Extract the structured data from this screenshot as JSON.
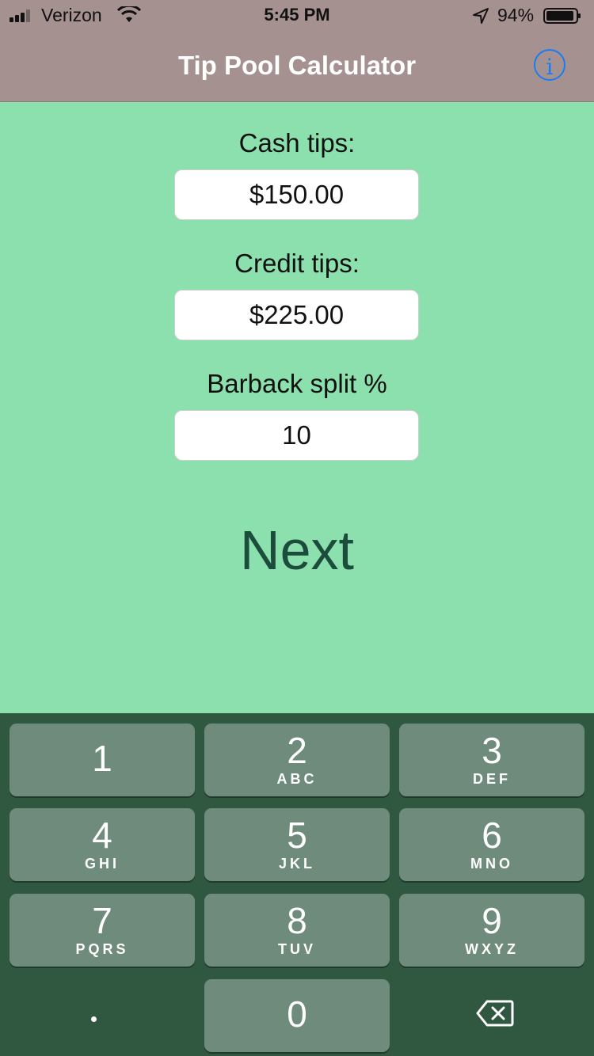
{
  "status_bar": {
    "carrier": "Verizon",
    "time": "5:45 PM",
    "battery_percent": "94%"
  },
  "nav": {
    "title": "Tip Pool Calculator",
    "info_glyph": "i"
  },
  "form": {
    "cash_label": "Cash tips:",
    "cash_value": "$150.00",
    "credit_label": "Credit tips:",
    "credit_value": "$225.00",
    "barback_label": "Barback split %",
    "barback_value": "10",
    "next_label": "Next"
  },
  "keypad": {
    "keys": [
      {
        "num": "1",
        "letters": ""
      },
      {
        "num": "2",
        "letters": "ABC"
      },
      {
        "num": "3",
        "letters": "DEF"
      },
      {
        "num": "4",
        "letters": "GHI"
      },
      {
        "num": "5",
        "letters": "JKL"
      },
      {
        "num": "6",
        "letters": "MNO"
      },
      {
        "num": "7",
        "letters": "PQRS"
      },
      {
        "num": "8",
        "letters": "TUV"
      },
      {
        "num": "9",
        "letters": "WXYZ"
      },
      {
        "num": "0",
        "letters": ""
      }
    ]
  },
  "colors": {
    "background": "#8be0ad",
    "nav_bar": "#a49190",
    "accent": "#1a7cf5",
    "keypad_bg": "#30573f",
    "key": "#6f8b7b",
    "next_text": "#1c4d3c"
  },
  "icons": [
    "signal-icon",
    "wifi-icon",
    "location-icon",
    "battery-icon",
    "info-icon",
    "backspace-icon"
  ]
}
